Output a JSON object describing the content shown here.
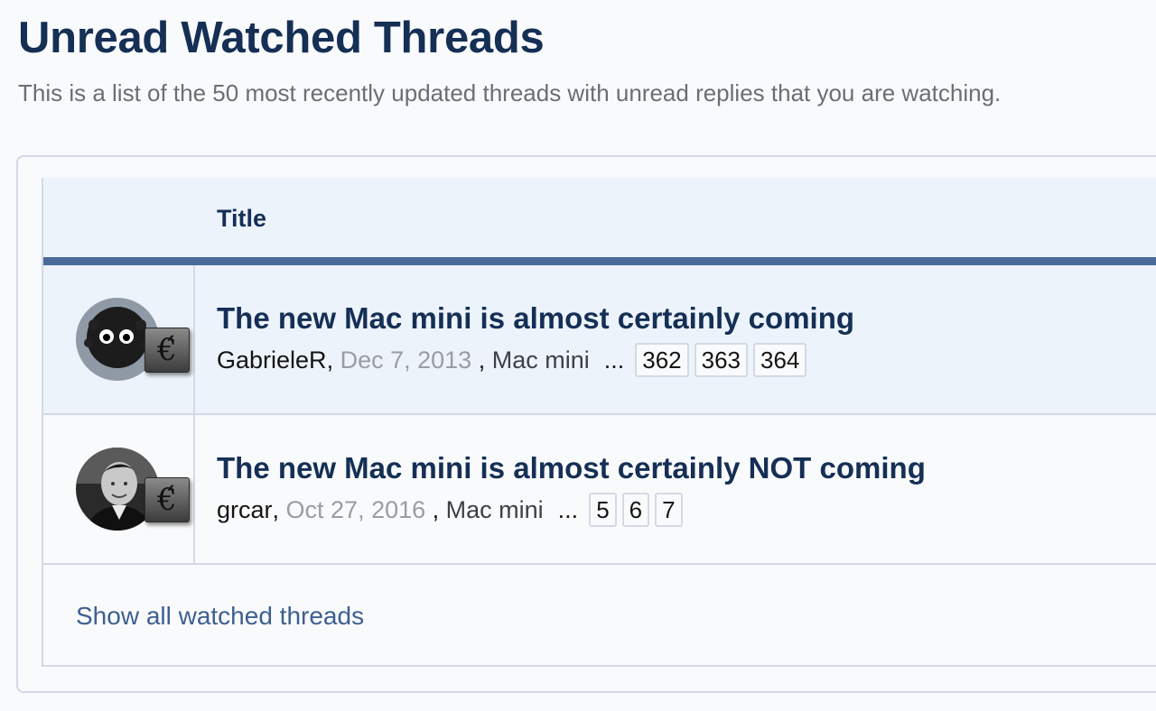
{
  "page": {
    "title": "Unread Watched Threads",
    "description": "This is a list of the 50 most recently updated threads with unread replies that you are watching."
  },
  "table": {
    "column_title": "Title",
    "threads": [
      {
        "title": "The new Mac mini is almost certainly coming",
        "author": "GabrieleR",
        "date": "Dec 7, 2013",
        "forum": "Mac mini",
        "ellipsis": "...",
        "pages": [
          "362",
          "363",
          "364"
        ],
        "avatar_icon": "soot-sprite-avatar",
        "badge_glyph": "€́"
      },
      {
        "title": "The new Mac mini is almost certainly NOT coming",
        "author": "grcar",
        "date": "Oct 27, 2016",
        "forum": "Mac mini",
        "ellipsis": "...",
        "pages": [
          "5",
          "6",
          "7"
        ],
        "avatar_icon": "person-photo-avatar",
        "badge_glyph": "€́"
      }
    ],
    "footer_link": "Show all watched threads"
  },
  "colors": {
    "heading": "#152f55",
    "header_bar": "#4a6a98",
    "row_highlight": "#ecf3fb",
    "link": "#3e6090",
    "border": "#d3dae5"
  }
}
